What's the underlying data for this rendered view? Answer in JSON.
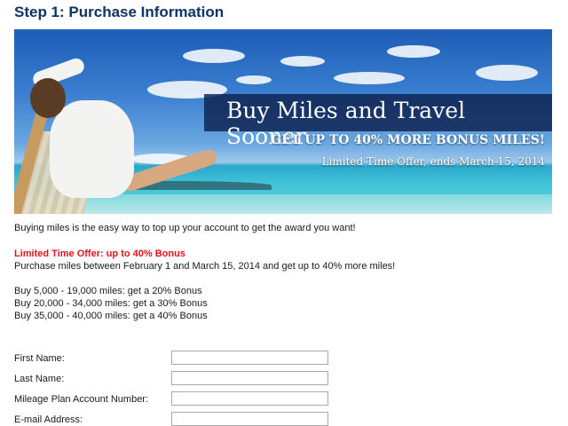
{
  "page": {
    "step_title": "Step 1: Purchase Information"
  },
  "banner": {
    "headline": "Buy Miles and Travel Sooner",
    "subheadline": "GET UP TO 40% MORE BONUS MILES!",
    "note": "Limited Time Offer, ends March 15, 2014"
  },
  "content": {
    "intro": "Buying miles is the easy way to top up your account to get the award you want!",
    "offer_heading": "Limited Time Offer: up to 40% Bonus",
    "offer_text": "Purchase miles between February 1 and March 15, 2014 and get up to 40% more miles!",
    "bonus_tiers": [
      "Buy 5,000 - 19,000 miles: get a 20% Bonus",
      "Buy 20,000 - 34,000 miles: get a 30% Bonus",
      "Buy 35,000 - 40,000 miles: get a 40% Bonus"
    ]
  },
  "form": {
    "fields": [
      {
        "label": "First Name:",
        "value": ""
      },
      {
        "label": "Last Name:",
        "value": ""
      },
      {
        "label": "Mileage Plan Account Number:",
        "value": ""
      },
      {
        "label": "E-mail Address:",
        "value": ""
      }
    ]
  }
}
